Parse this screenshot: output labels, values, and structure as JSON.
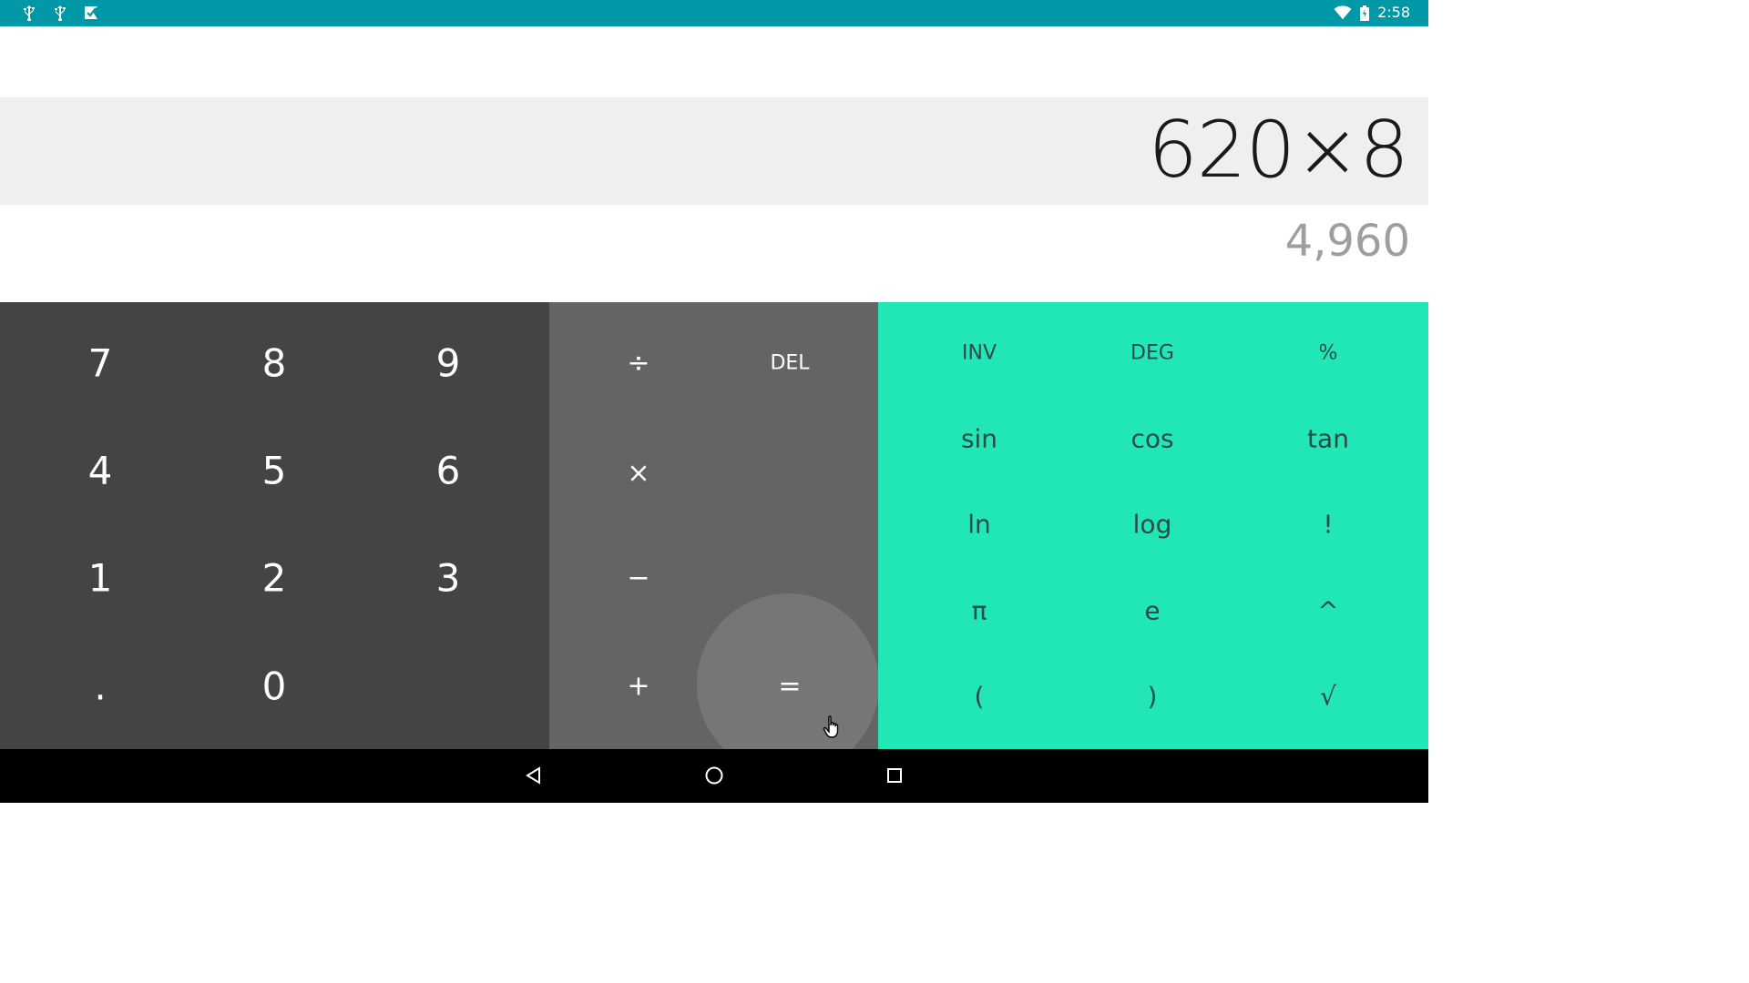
{
  "status_bar": {
    "time": "2:58",
    "left_icons": [
      "usb-icon",
      "usb-icon",
      "play-store-icon"
    ],
    "right_icons": [
      "wifi-icon",
      "battery-icon"
    ],
    "color": "#0097a7"
  },
  "display": {
    "formula": "620×8",
    "result": "4,960"
  },
  "numpad": {
    "keys": [
      "7",
      "8",
      "9",
      "4",
      "5",
      "6",
      "1",
      "2",
      "3",
      ".",
      "0"
    ]
  },
  "operators": {
    "divide": "÷",
    "delete": "DEL",
    "multiply": "×",
    "minus": "−",
    "plus": "+",
    "equals": "="
  },
  "advanced": {
    "keys": [
      "INV",
      "DEG",
      "%",
      "sin",
      "cos",
      "tan",
      "ln",
      "log",
      "!",
      "π",
      "e",
      "^",
      "(",
      ")",
      "√"
    ],
    "color": "#21e7b6"
  },
  "nav_bar": {
    "icons": [
      "back-icon",
      "home-icon",
      "recents-icon"
    ]
  }
}
